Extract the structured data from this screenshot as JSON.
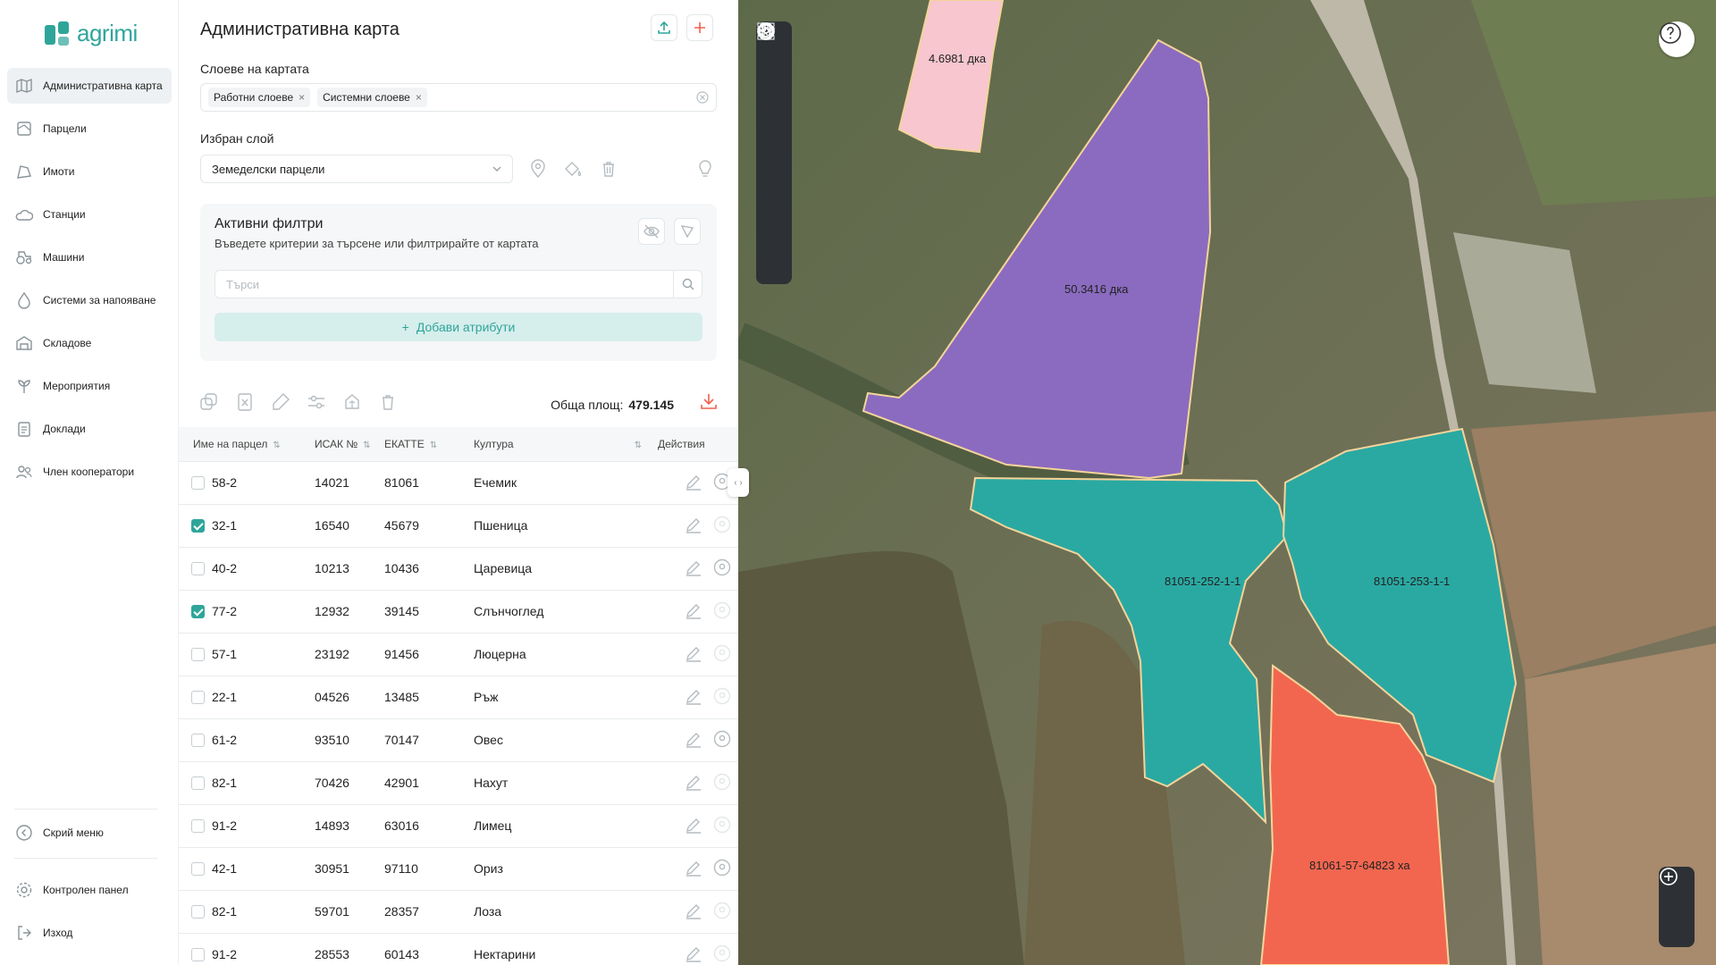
{
  "app": {
    "logo_text": "agrimi",
    "brand_color": "#2fa59a",
    "accent_color": "#f0614f"
  },
  "sidebar": {
    "items": [
      {
        "label": "Административна карта",
        "icon": "map-icon",
        "active": true
      },
      {
        "label": "Парцели",
        "icon": "parcel-icon"
      },
      {
        "label": "Имоти",
        "icon": "property-icon"
      },
      {
        "label": "Станции",
        "icon": "station-icon"
      },
      {
        "label": "Машини",
        "icon": "tractor-icon"
      },
      {
        "label": "Системи за напояване",
        "icon": "droplet-icon"
      },
      {
        "label": "Складове",
        "icon": "warehouse-icon"
      },
      {
        "label": "Мероприятия",
        "icon": "plant-icon"
      },
      {
        "label": "Доклади",
        "icon": "report-icon"
      },
      {
        "label": "Член кооператори",
        "icon": "users-icon"
      }
    ],
    "hide_menu": "Скрий меню",
    "control_panel": "Контролен панел",
    "logout": "Изход"
  },
  "panel": {
    "title": "Административна карта",
    "layers_label": "Слоеве на картата",
    "layers": [
      "Работни слоеве",
      "Системни слоеве"
    ],
    "selected_layer_label": "Избран слой",
    "selected_layer_value": "Земеделски парцели",
    "filters": {
      "title": "Активни филтри",
      "subtitle": "Въведете критерии за търсене или филтрирайте от картата",
      "search_placeholder": "Търси",
      "add_attributes": "Добави атрибути"
    },
    "total_label": "Обща площ:",
    "total_value": "479.145"
  },
  "table": {
    "columns": [
      "Име на парцел",
      "ИСАК №",
      "ЕКАТТЕ",
      "Култура",
      "Действия"
    ],
    "rows": [
      {
        "name": "58-2",
        "isak": "14021",
        "ekatte": "81061",
        "crop": "Ечемик",
        "checked": false,
        "pin_active": true
      },
      {
        "name": "32-1",
        "isak": "16540",
        "ekatte": "45679",
        "crop": "Пшеница",
        "checked": true,
        "pin_active": false
      },
      {
        "name": "40-2",
        "isak": "10213",
        "ekatte": "10436",
        "crop": "Царевица",
        "checked": false,
        "pin_active": true
      },
      {
        "name": "77-2",
        "isak": "12932",
        "ekatte": "39145",
        "crop": "Слънчоглед",
        "checked": true,
        "pin_active": false
      },
      {
        "name": "57-1",
        "isak": "23192",
        "ekatte": "91456",
        "crop": "Люцерна",
        "checked": false,
        "pin_active": false
      },
      {
        "name": "22-1",
        "isak": "04526",
        "ekatte": "13485",
        "crop": "Ръж",
        "checked": false,
        "pin_active": false
      },
      {
        "name": "61-2",
        "isak": "93510",
        "ekatte": "70147",
        "crop": "Овес",
        "checked": false,
        "pin_active": true
      },
      {
        "name": "82-1",
        "isak": "70426",
        "ekatte": "42901",
        "crop": "Нахут",
        "checked": false,
        "pin_active": false
      },
      {
        "name": "91-2",
        "isak": "14893",
        "ekatte": "63016",
        "crop": "Лимец",
        "checked": false,
        "pin_active": false
      },
      {
        "name": "42-1",
        "isak": "30951",
        "ekatte": "97110",
        "crop": "Ориз",
        "checked": false,
        "pin_active": true
      },
      {
        "name": "82-1",
        "isak": "59701",
        "ekatte": "28357",
        "crop": "Лоза",
        "checked": false,
        "pin_active": false
      },
      {
        "name": "91-2",
        "isak": "28553",
        "ekatte": "60143",
        "crop": "Нектарини",
        "checked": false,
        "pin_active": false
      }
    ]
  },
  "map": {
    "parcels": [
      {
        "label": "4.6981 дка",
        "color": "#f7c6cf"
      },
      {
        "label": "50.3416 дка",
        "color": "#8a6bbf"
      },
      {
        "label": "81051-252-1-1",
        "color": "#2aa9a2"
      },
      {
        "label": "81051-253-1-1",
        "color": "#2aa9a2"
      },
      {
        "label": "81061-57-64823 ха",
        "color": "#f26650"
      }
    ]
  }
}
